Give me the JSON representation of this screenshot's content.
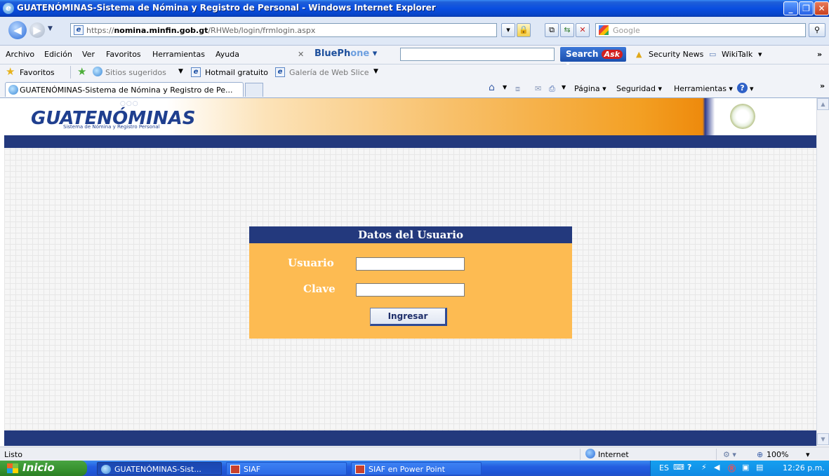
{
  "window": {
    "title": "GUATENÓMINAS-Sistema de Nómina y Registro de Personal - Windows Internet Explorer"
  },
  "address": {
    "url_prefix": "https://",
    "url_host": "nomina.minfin.gob.gt",
    "url_path": "/RHWeb/login/frmlogin.aspx",
    "search_placeholder": "Google"
  },
  "menubar": {
    "items": [
      "Archivo",
      "Edición",
      "Ver",
      "Favoritos",
      "Herramientas",
      "Ayuda"
    ],
    "bluephone_a": "BluePh",
    "bluephone_b": "one",
    "search_label": "Search",
    "ask_label": "Ask",
    "security_news": "Security News",
    "wikitalk": "WikiTalk"
  },
  "favbar": {
    "favoritos": "Favoritos",
    "sitios": "Sitios sugeridos",
    "hotmail": "Hotmail gratuito",
    "galeria": "Galería de Web Slice"
  },
  "tabs": {
    "active_tab": "GUATENÓMINAS-Sistema de Nómina y Registro de Pe...",
    "pagina": "Página",
    "seguridad": "Seguridad",
    "herramientas": "Herramientas"
  },
  "page": {
    "logo": "GUATENÓMINAS",
    "logo_sub": "Sistema de Nómina y Registro Personal",
    "login": {
      "header": "Datos del Usuario",
      "user_label": "Usuario",
      "password_label": "Clave",
      "user_value": "",
      "password_value": "",
      "submit_label": "Ingresar"
    }
  },
  "statusbar": {
    "status": "Listo",
    "zone": "Internet",
    "zoom": "100%"
  },
  "taskbar": {
    "start": "Inicio",
    "tasks": [
      "GUATENÓMINAS-Sist...",
      "SIAF",
      "SIAF en Power Point"
    ],
    "lang": "ES",
    "clock": "12:26 p.m."
  },
  "colors": {
    "navy": "#23397d",
    "orange_panel": "#fdbb52",
    "xp_blue": "#245ee0"
  }
}
